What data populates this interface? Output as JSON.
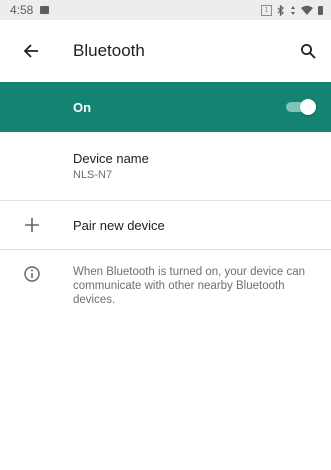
{
  "status_bar": {
    "time": "4:58",
    "sim_label": "1",
    "icons": [
      "image-icon",
      "sim-icon",
      "bluetooth-icon",
      "data-icon",
      "wifi-icon",
      "battery-icon"
    ]
  },
  "app_bar": {
    "title": "Bluetooth",
    "back_icon": "back-arrow-icon",
    "search_icon": "search-icon"
  },
  "bluetooth_toggle": {
    "label": "On",
    "state": true,
    "accent_color": "#138373"
  },
  "device_name": {
    "title": "Device name",
    "value": "NLS-N7"
  },
  "pair_new_device": {
    "label": "Pair new device",
    "icon": "plus-icon"
  },
  "info": {
    "icon": "info-icon",
    "text": "When Bluetooth is turned on, your device can communicate with other nearby Bluetooth devices."
  }
}
